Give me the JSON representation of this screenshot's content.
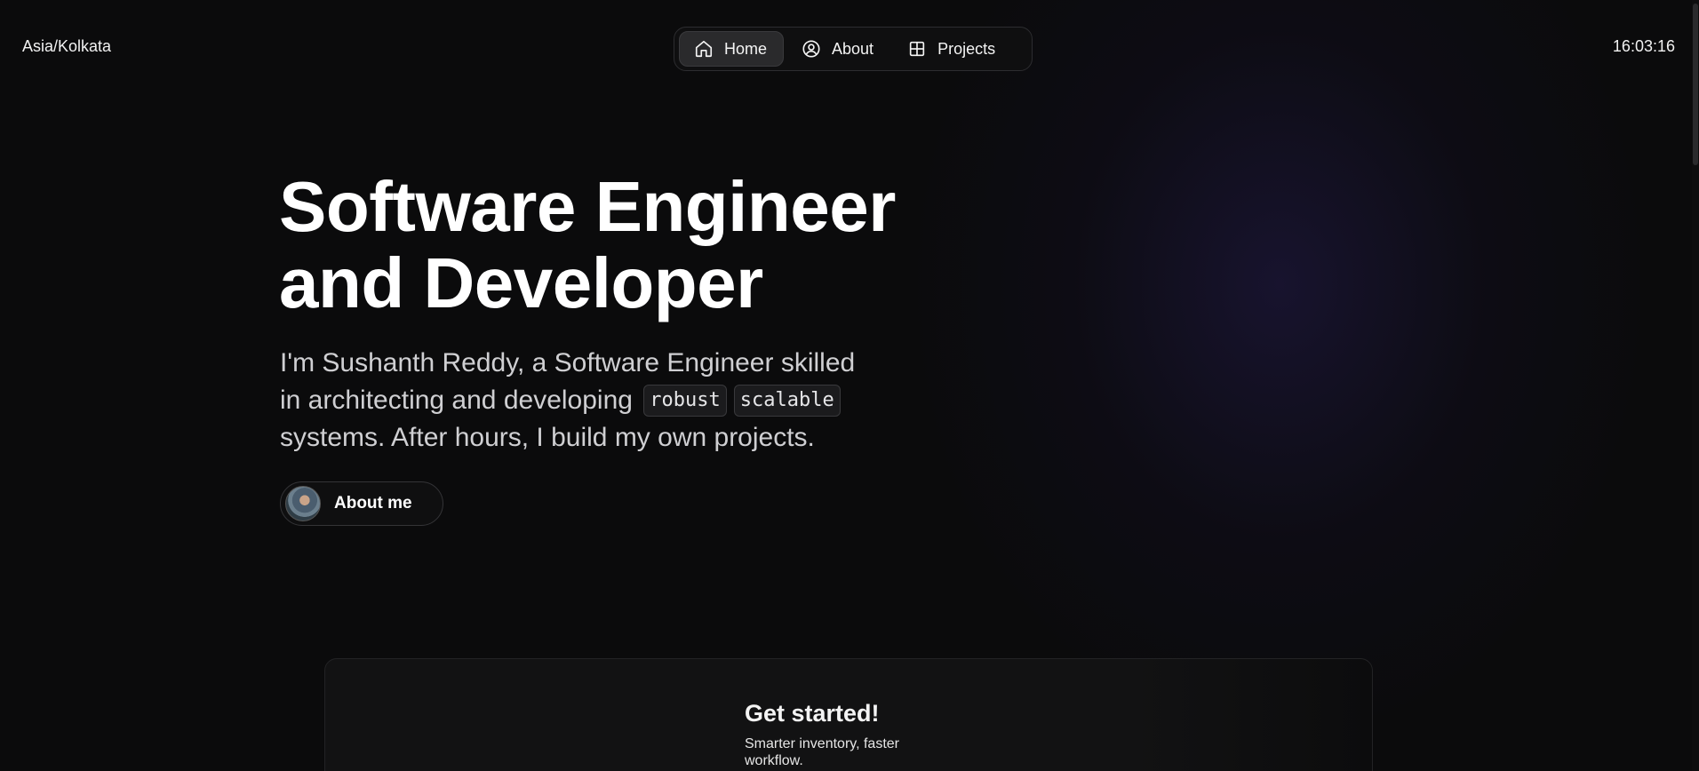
{
  "header": {
    "timezone": "Asia/Kolkata",
    "clock": "16:03:16"
  },
  "nav": {
    "items": [
      {
        "label": "Home",
        "icon": "home-icon",
        "active": true
      },
      {
        "label": "About",
        "icon": "user-circle-icon",
        "active": false
      },
      {
        "label": "Projects",
        "icon": "grid-icon",
        "active": false
      }
    ]
  },
  "hero": {
    "title_line1": "Software Engineer",
    "title_line2": "and Developer",
    "intro_line1": "I'm Sushanth Reddy, a Software Engineer skilled",
    "intro_line2_prefix": "in architecting and developing",
    "tag_robust": "robust",
    "tag_scalable": "scalable",
    "intro_line3": "systems. After hours, I build my own projects.",
    "about_button": "About me"
  },
  "card": {
    "title": "Get started!",
    "subtitle": "Smarter inventory, faster workflow."
  },
  "colors": {
    "background": "#0b0b0c",
    "accent_glow": "#221a4a",
    "text_primary": "#ffffff",
    "text_secondary": "#cfcfd2"
  }
}
